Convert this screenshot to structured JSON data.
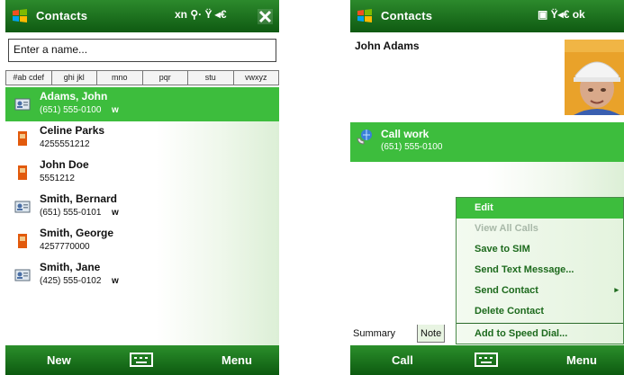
{
  "left_screen": {
    "title": "Contacts",
    "tray": "xn ⚲· Ÿ ◂€",
    "search_placeholder": "Enter a name...",
    "tabs": [
      "#ab cdef",
      "ghi jkl",
      "mno",
      "pqr",
      "stu",
      "vwxyz"
    ],
    "contacts": [
      {
        "name": "Adams, John",
        "number": "(651) 555-0100",
        "type": "w",
        "icon": "contact-card-icon",
        "selected": true
      },
      {
        "name": "Celine Parks",
        "number": "4255551212",
        "type": "",
        "icon": "sim-card-icon",
        "selected": false
      },
      {
        "name": "John Doe",
        "number": "5551212",
        "type": "",
        "icon": "sim-card-icon",
        "selected": false
      },
      {
        "name": "Smith, Bernard",
        "number": "(651) 555-0101",
        "type": "w",
        "icon": "contact-card-icon",
        "selected": false
      },
      {
        "name": "Smith, George",
        "number": "4257770000",
        "type": "",
        "icon": "sim-card-icon",
        "selected": false
      },
      {
        "name": "Smith, Jane",
        "number": "(425) 555-0102",
        "type": "w",
        "icon": "contact-card-icon",
        "selected": false
      }
    ],
    "softkeys": {
      "left": "New",
      "right": "Menu"
    }
  },
  "right_screen": {
    "title": "Contacts",
    "tray": "▣ Ÿ◂€ ok",
    "contact_name": "John Adams",
    "call_label": "Call work",
    "call_number": "(651) 555-0100",
    "tabs": [
      "Summary",
      "Note"
    ],
    "menu_items": [
      {
        "label": "Edit",
        "state": "selected",
        "submenu": false
      },
      {
        "label": "View All Calls",
        "state": "disabled",
        "submenu": false
      },
      {
        "label": "Save to SIM",
        "state": "normal",
        "submenu": false
      },
      {
        "label": "Send Text Message...",
        "state": "normal",
        "submenu": false
      },
      {
        "label": "Send Contact",
        "state": "normal",
        "submenu": true
      },
      {
        "label": "Delete Contact",
        "state": "normal",
        "submenu": false
      },
      {
        "label": "Add to Speed Dial...",
        "state": "normal",
        "submenu": false
      }
    ],
    "softkeys": {
      "left": "Call",
      "right": "Menu"
    }
  },
  "colors": {
    "title_bar": "#1f7a22",
    "selection": "#3dbd3d",
    "menu_text": "#1d6a1d"
  }
}
